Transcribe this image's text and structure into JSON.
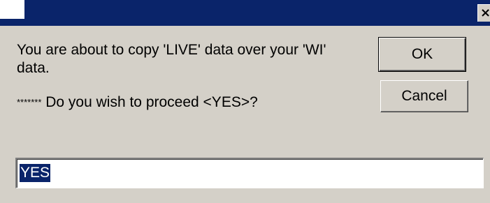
{
  "dialog": {
    "message_line1": "You are about to copy 'LIVE' data over your 'WI'",
    "message_line2": "data.",
    "question_prefix": "*******",
    "question_text": " Do you wish to proceed <YES>?",
    "ok_label": "OK",
    "cancel_label": "Cancel",
    "input_value": "YES",
    "close_glyph": "×"
  },
  "colors": {
    "face": "#d4d0c8",
    "titlebar": "#0a246a",
    "selection": "#0a246a"
  }
}
